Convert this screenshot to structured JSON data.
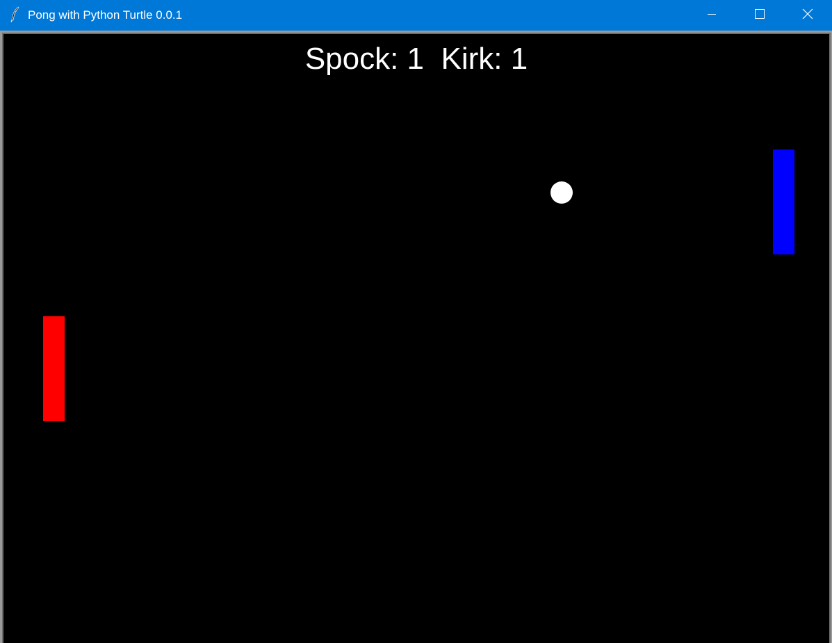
{
  "window": {
    "title": "Pong with Python Turtle 0.0.1",
    "titlebar_color": "#0078d7",
    "title_text_color": "#ffffff",
    "icon": "feather-icon",
    "controls": {
      "minimize_icon": "minimize-icon",
      "maximize_icon": "maximize-icon",
      "close_icon": "close-icon"
    }
  },
  "game": {
    "background_color": "#000000",
    "score_text": "Spock: 1  Kirk: 1",
    "score_color": "#ffffff",
    "players": [
      {
        "name": "Spock",
        "score": 1,
        "paddle_color": "#ff0000"
      },
      {
        "name": "Kirk",
        "score": 1,
        "paddle_color": "#0000ff"
      }
    ],
    "ball_color": "#ffffff"
  }
}
